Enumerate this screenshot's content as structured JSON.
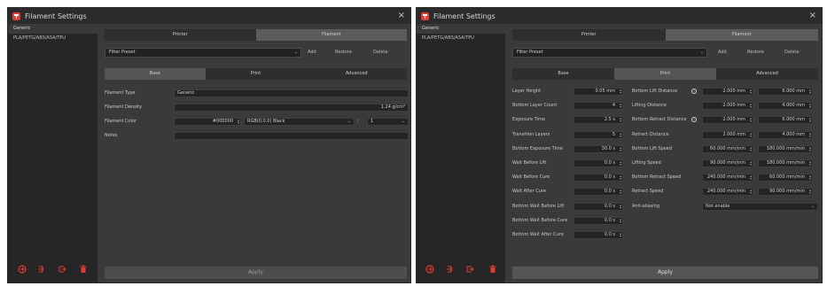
{
  "app": {
    "title": "Filament Settings",
    "close": "×"
  },
  "colors": {
    "accent": "#e03c31"
  },
  "left": {
    "sidebar": [
      "Generic",
      "PLA/PETG/ABS/ASA/TPU"
    ],
    "tabs": [
      "Printer",
      "Filament"
    ],
    "filter": "Filter Preset",
    "actions": [
      "Add",
      "Restore",
      "Delete"
    ],
    "subtabs": [
      "Base",
      "Print",
      "Advanced"
    ],
    "fields": {
      "type_label": "Filament Type",
      "type_value": "Generic",
      "density_label": "Filament Density",
      "density_value": "1.24 g/cm³",
      "color_label": "Filament Color",
      "color_hex": "#000000",
      "color_name": "RGB(0,0,0) Black",
      "extra_value": "1",
      "notes_label": "Notes"
    },
    "apply": "Apply"
  },
  "right": {
    "sidebar": [
      "Generic",
      "PLA/PETG/ABS/ASA/TPU"
    ],
    "tabs": [
      "Printer",
      "Filament"
    ],
    "filter": "Filter Preset",
    "actions": [
      "Add",
      "Restore",
      "Delete"
    ],
    "subtabs": [
      "Base",
      "Print",
      "Advanced"
    ],
    "col1": [
      {
        "label": "Layer Height",
        "value": "0.05 mm"
      },
      {
        "label": "Bottom Layer Count",
        "value": "4"
      },
      {
        "label": "Exposure Time",
        "value": "2.5 s"
      },
      {
        "label": "Transition Layers",
        "value": "5"
      },
      {
        "label": "Bottom Exposure Time",
        "value": "30.0 s"
      },
      {
        "label": "Wait Before Lift",
        "value": "0.0 s"
      },
      {
        "label": "Wait Before Cure",
        "value": "0.0 s"
      },
      {
        "label": "Wait After Cure",
        "value": "0.0 s"
      },
      {
        "label": "Bottom Wait Before Lift",
        "value": "0.0 s"
      },
      {
        "label": "Bottom Wait Before Cure",
        "value": "0.0 s"
      },
      {
        "label": "Bottom Wait After Cure",
        "value": "0.0 s"
      }
    ],
    "col2": [
      {
        "label": "Bottom Lift Distance",
        "v1": "2.000 mm",
        "v2": "6.000 mm",
        "info": true
      },
      {
        "label": "Lifting Distance",
        "v1": "2.000 mm",
        "v2": "4.000 mm",
        "info": false
      },
      {
        "label": "Bottom Retract Distance",
        "v1": "2.000 mm",
        "v2": "6.000 mm",
        "info": true
      },
      {
        "label": "Retract Distance",
        "v1": "2.000 mm",
        "v2": "4.000 mm",
        "info": false
      },
      {
        "label": "Bottom Lift Speed",
        "v1": "60.000 mm/min",
        "v2": "180.000 mm/min",
        "info": false
      },
      {
        "label": "Lifting Speed",
        "v1": "90.000 mm/min",
        "v2": "180.000 mm/min",
        "info": false
      },
      {
        "label": "Bottom Retract Speed",
        "v1": "240.000 mm/min",
        "v2": "60.000 mm/min",
        "info": false
      },
      {
        "label": "Retract Speed",
        "v1": "240.000 mm/min",
        "v2": "90.000 mm/min",
        "info": false
      }
    ],
    "anti_label": "Anti-aliasing",
    "anti_value": "Not enable",
    "apply": "Apply"
  }
}
